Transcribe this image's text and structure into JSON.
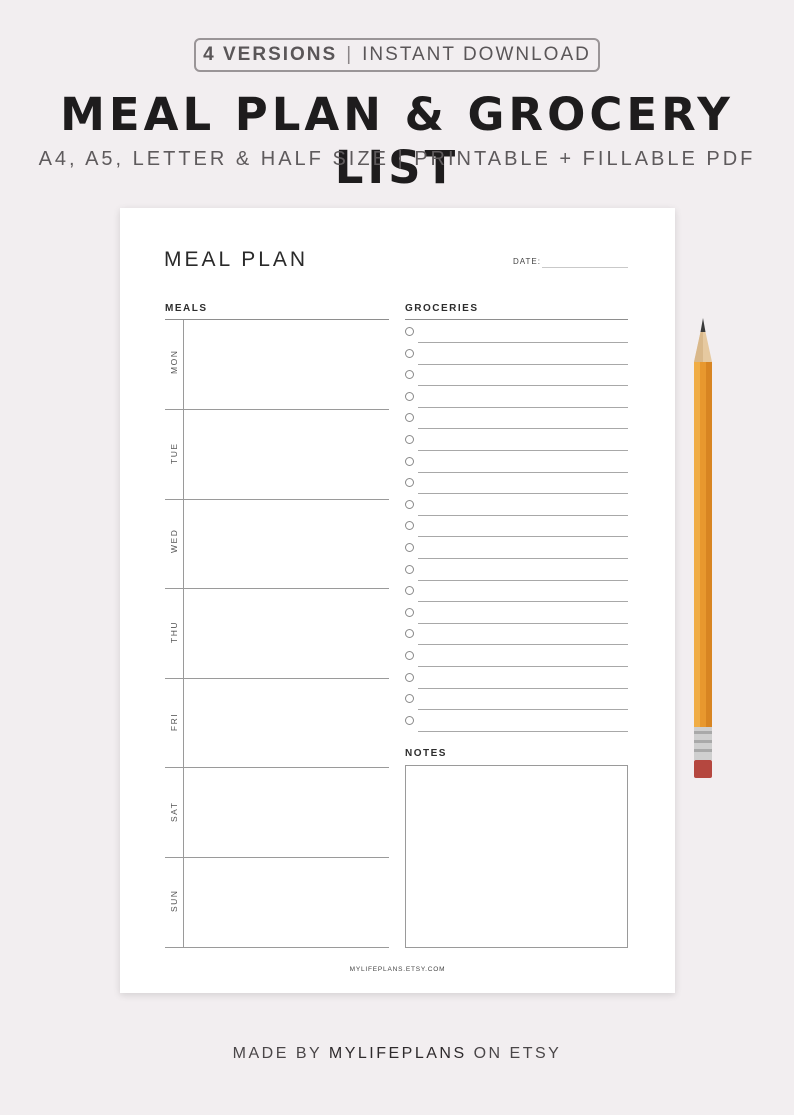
{
  "header": {
    "badge_bold": "4 VERSIONS",
    "badge_sep": "|",
    "badge_rest": "INSTANT DOWNLOAD",
    "title": "MEAL PLAN & GROCERY LIST",
    "subtitle": "A4, A5, LETTER & HALF SIZE | PRINTABLE + FILLABLE PDF"
  },
  "sheet": {
    "title": "MEAL PLAN",
    "date_label": "DATE:",
    "meals_label": "MEALS",
    "groceries_label": "GROCERIES",
    "notes_label": "NOTES",
    "days": [
      "MON",
      "TUE",
      "WED",
      "THU",
      "FRI",
      "SAT",
      "SUN"
    ],
    "grocery_checkbox_count": 19,
    "footer_url": "MYLIFEPLANS.ETSY.COM"
  },
  "footer": {
    "made_by_prefix": "MADE BY",
    "made_by_shop": "MYLIFEPLANS",
    "made_by_suffix": "ON ETSY"
  },
  "colors": {
    "background": "#f2eef0",
    "sheet": "#ffffff",
    "pencil_body": "#e8982e",
    "pencil_eraser": "#b5473f"
  },
  "icons": [
    "pencil-icon",
    "checkbox-circle-icon"
  ]
}
